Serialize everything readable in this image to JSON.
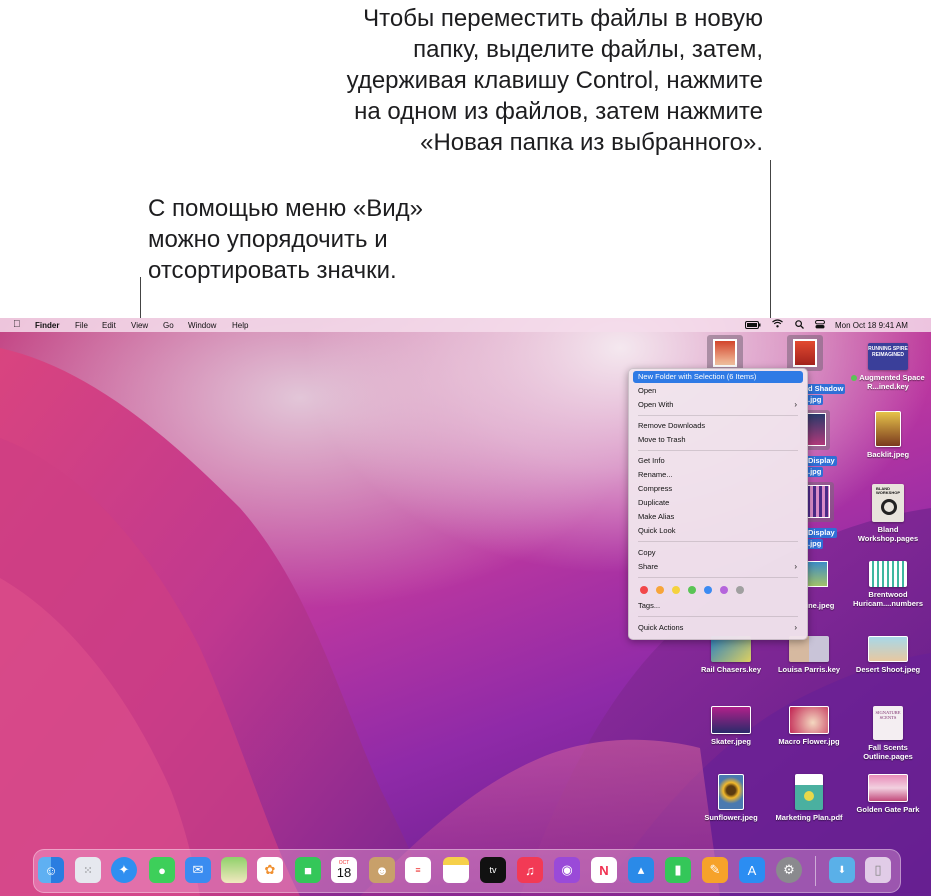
{
  "callouts": {
    "right": [
      "Чтобы переместить файлы в новую",
      "папку, выделите файлы, затем,",
      "удерживая клавишу Control, нажмите",
      "на одном из файлов, затем нажмите",
      "«Новая папка из выбранного»."
    ],
    "left": [
      "С помощью меню «Вид»",
      "можно упорядочить и",
      "отсортировать значки."
    ]
  },
  "menubar": {
    "apple": "",
    "app": "Finder",
    "menus": [
      "File",
      "Edit",
      "View",
      "Go",
      "Window",
      "Help"
    ],
    "clock": "Mon Oct 18  9:41 AM"
  },
  "context_menu": {
    "items": [
      {
        "label": "New Folder with Selection (6 Items)",
        "highlighted": true
      },
      {
        "label": "Open"
      },
      {
        "label": "Open With",
        "submenu": true
      },
      {
        "label": "Remove Downloads"
      },
      {
        "label": "Move to Trash"
      },
      {
        "label": "Get Info"
      },
      {
        "label": "Rename..."
      },
      {
        "label": "Compress"
      },
      {
        "label": "Duplicate"
      },
      {
        "label": "Make Alias"
      },
      {
        "label": "Quick Look"
      },
      {
        "label": "Copy"
      },
      {
        "label": "Share",
        "submenu": true
      },
      {
        "label": "Tags..."
      },
      {
        "label": "Quick Actions",
        "submenu": true
      }
    ],
    "tag_colors": [
      "#f2474a",
      "#f7a53a",
      "#f5d23e",
      "#5ac455",
      "#3c8af2",
      "#b565dc",
      "#a0a0a0"
    ]
  },
  "desktop_files": {
    "drop_shadow": [
      "d Shadow",
      ".jpg"
    ],
    "display1": [
      "Display",
      ".jpg"
    ],
    "display2": [
      "Display",
      ".jpg"
    ],
    "augmented": "Augmented Space R...ined.key",
    "backlit": "Backlit.jpeg",
    "bland": "Bland Workshop.pages",
    "ine": "ine.jpeg",
    "brentwood": "Brentwood Huricam....numbers",
    "rail": "Rail Chasers.key",
    "louisa": "Louisa Parris.key",
    "desert": "Desert Shoot.jpeg",
    "skater": "Skater.jpeg",
    "macro": "Macro Flower.jpg",
    "fall": "Fall Scents Outline.pages",
    "sunflower": "Sunflower.jpeg",
    "marketing": "Marketing Plan.pdf",
    "golden": "Golden Gate Park",
    "augmented_thumb_text": "RUNNING SPIRE REIMAGINED",
    "bland_thumb_text": "BLAND WORKSHOP",
    "fall_thumb_text": "SIGNATURE SCENTS"
  },
  "dock": {
    "calendar_month": "OCT",
    "calendar_day": "18",
    "tv_label": "tv"
  }
}
